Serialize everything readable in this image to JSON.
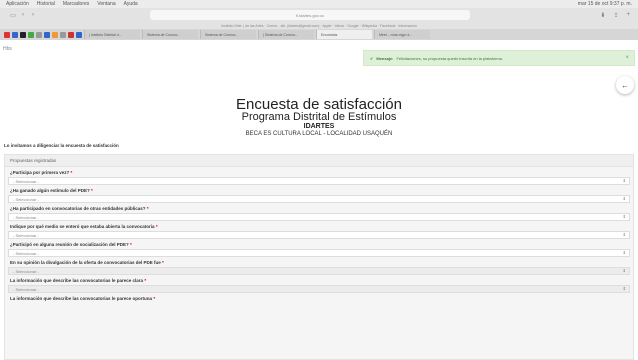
{
  "menubar": {
    "items": [
      "Aplicación",
      "Historial",
      "Marcadores",
      "Ventana",
      "Ayuda"
    ],
    "clock": "mar 15 de oct 9:37 p. m."
  },
  "browser": {
    "url": "fi.idartes.gov.co",
    "bookmarks": "Instituto Distr. | de las Artes · Correo - alb. (idartes@gmail.com) · Apple · Yahoo · Google · Wikipedia · Facebook · Informacion",
    "tabs": [
      "| Instituto Distrital d...",
      "Sistema de Convoc...",
      "Sistema de Convoc...",
      "| Sistema de Convoc...",
      "Encuestas",
      "Meet – mna-mypr-k..."
    ]
  },
  "page": {
    "breadcrumb": "Hbs",
    "toast": {
      "icon": "✔",
      "label": "Mensaje:",
      "text": "Felicitaciones, su propuesta quedó inscrita en la plataforma.",
      "close": "×"
    },
    "back_icon": "←",
    "title": "Encuesta de satisfacción",
    "subtitle": "Programa Distrital de Estímulos",
    "entity": "IDARTES",
    "program": "BECA ES CULTURA LOCAL - LOCALIDAD USAQUÉN",
    "invite": "Lo invitamos a diligenciar la encuesta de satisfacción",
    "card_header": "Propuestas registradas",
    "select_placeholder": "- Seleccionar -",
    "questions": [
      "¿Participa por primera vez?",
      "¿Ha ganado algún estímulo del PDE?",
      "¿Ha participado en convocatorias de otras entidades públicas?",
      "Indique por qué medio se enteró que estaba abierta la convocatoria",
      "¿Participó en alguna reunión de socialización del PDE?",
      "En su opinión la divulgación de la oferta de convocatorias del PDE fue",
      "La información que describe las convocatorias le parece clara",
      "La información que describe las convocatorias le parece oportuna"
    ]
  }
}
